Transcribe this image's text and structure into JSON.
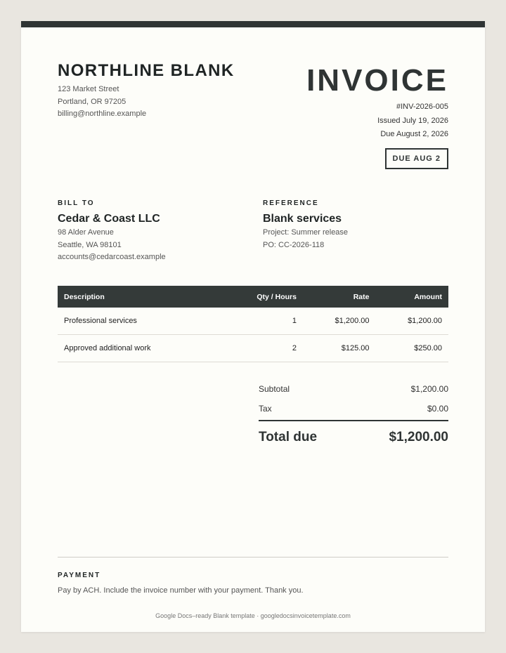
{
  "company": {
    "name": "NORTHLINE BLANK",
    "address_line1": "123 Market Street",
    "address_line2": "Portland, OR 97205",
    "email": "billing@northline.example"
  },
  "invoice": {
    "title": "INVOICE",
    "number": "#INV-2026-005",
    "issued": "Issued July 19, 2026",
    "due": "Due August 2, 2026",
    "due_badge": "DUE AUG 2"
  },
  "bill_to": {
    "label": "BILL TO",
    "name": "Cedar & Coast LLC",
    "address_line1": "98 Alder Avenue",
    "address_line2": "Seattle, WA 98101",
    "email": "accounts@cedarcoast.example"
  },
  "reference": {
    "label": "REFERENCE",
    "title": "Blank services",
    "project": "Project: Summer release",
    "po": "PO: CC-2026-118"
  },
  "table": {
    "headers": {
      "description": "Description",
      "qty": "Qty / Hours",
      "rate": "Rate",
      "amount": "Amount"
    },
    "rows": [
      {
        "description": "Professional services",
        "qty": "1",
        "rate": "$1,200.00",
        "amount": "$1,200.00"
      },
      {
        "description": "Approved additional work",
        "qty": "2",
        "rate": "$125.00",
        "amount": "$250.00"
      }
    ]
  },
  "totals": {
    "subtotal_label": "Subtotal",
    "subtotal": "$1,200.00",
    "tax_label": "Tax",
    "tax": "$0.00",
    "total_label": "Total due",
    "total": "$1,200.00"
  },
  "payment": {
    "label": "PAYMENT",
    "text": "Pay by ACH. Include the invoice number with your payment. Thank you."
  },
  "footer": "Google Docs–ready Blank template · googledocsinvoicetemplate.com",
  "colors": {
    "accent": "#2f3434",
    "page_bg": "#fdfdf9",
    "backdrop": "#e9e6e0"
  }
}
